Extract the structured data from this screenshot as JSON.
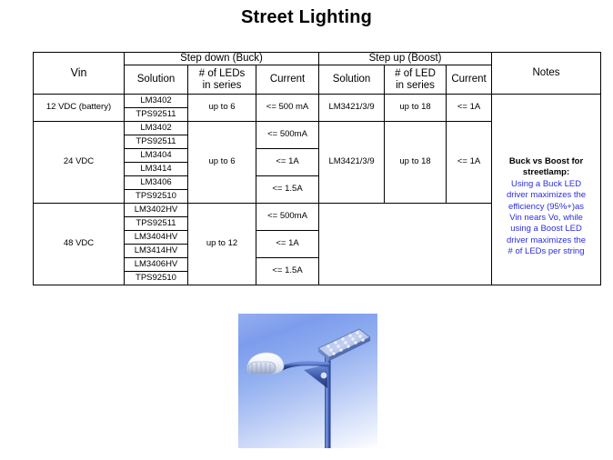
{
  "slide": {
    "title": "Street Lighting"
  },
  "table": {
    "group_headers": {
      "vin": "Vin",
      "buck": "Step down (Buck)",
      "boost": "Step up (Boost)",
      "notes": "Notes"
    },
    "sub_headers": {
      "buck_solution": "Solution",
      "buck_leds": "# of LEDs\nin series",
      "buck_leds_line1": "# of LEDs",
      "buck_leds_line2": "in series",
      "buck_current": "Current",
      "boost_solution": "Solution",
      "boost_leds_line1": "# of LED",
      "boost_leds_line2": "in series",
      "boost_current": "Current"
    },
    "rows": [
      {
        "vin": "12 VDC (battery)",
        "buck_solutions": [
          "LM3402",
          "TPS92511"
        ],
        "buck_leds": "up to 6",
        "buck_currents": [
          {
            "value": "<= 500 mA",
            "span": 2
          }
        ],
        "boost_solution": "LM3421/3/9",
        "boost_leds": "up to 18",
        "boost_current": "<= 1A"
      },
      {
        "vin": "24 VDC",
        "buck_solutions": [
          "LM3402",
          "TPS92511",
          "LM3404",
          "LM3414",
          "LM3406",
          "TPS92510"
        ],
        "buck_leds": "up to 6",
        "buck_currents": [
          {
            "value": "<= 500mA",
            "span": 2
          },
          {
            "value": "<= 1A",
            "span": 2
          },
          {
            "value": "<= 1.5A",
            "span": 2
          }
        ],
        "boost_solution": "LM3421/3/9",
        "boost_leds": "up to 18",
        "boost_current": "<= 1A"
      },
      {
        "vin": "48 VDC",
        "buck_solutions": [
          "LM3402HV",
          "TPS92511",
          "LM3404HV",
          "LM3414HV",
          "LM3406HV",
          "TPS92510"
        ],
        "buck_leds": "up to 12",
        "buck_currents": [
          {
            "value": "<= 500mA",
            "span": 2
          },
          {
            "value": "<= 1A",
            "span": 2
          },
          {
            "value": "<= 1.5A",
            "span": 2
          }
        ],
        "boost_solution": "",
        "boost_leds": "",
        "boost_current": ""
      }
    ],
    "notes": {
      "title_line1": "Buck vs Boost for",
      "title_line2": "streetlamp:",
      "body_line1": "Using a Buck LED",
      "body_line2": "driver maximizes the",
      "body_line3": "efficiency (95%+)as",
      "body_line4": "Vin nears Vo, while",
      "body_line5": "using a Boost LED",
      "body_line6": "driver maximizes the",
      "body_line7": "# of LEDs  per string"
    }
  },
  "photo": {
    "alt": "street-lamp-photo",
    "sky_color": "#7d9cec",
    "pole_color": "#3a5bbf"
  }
}
